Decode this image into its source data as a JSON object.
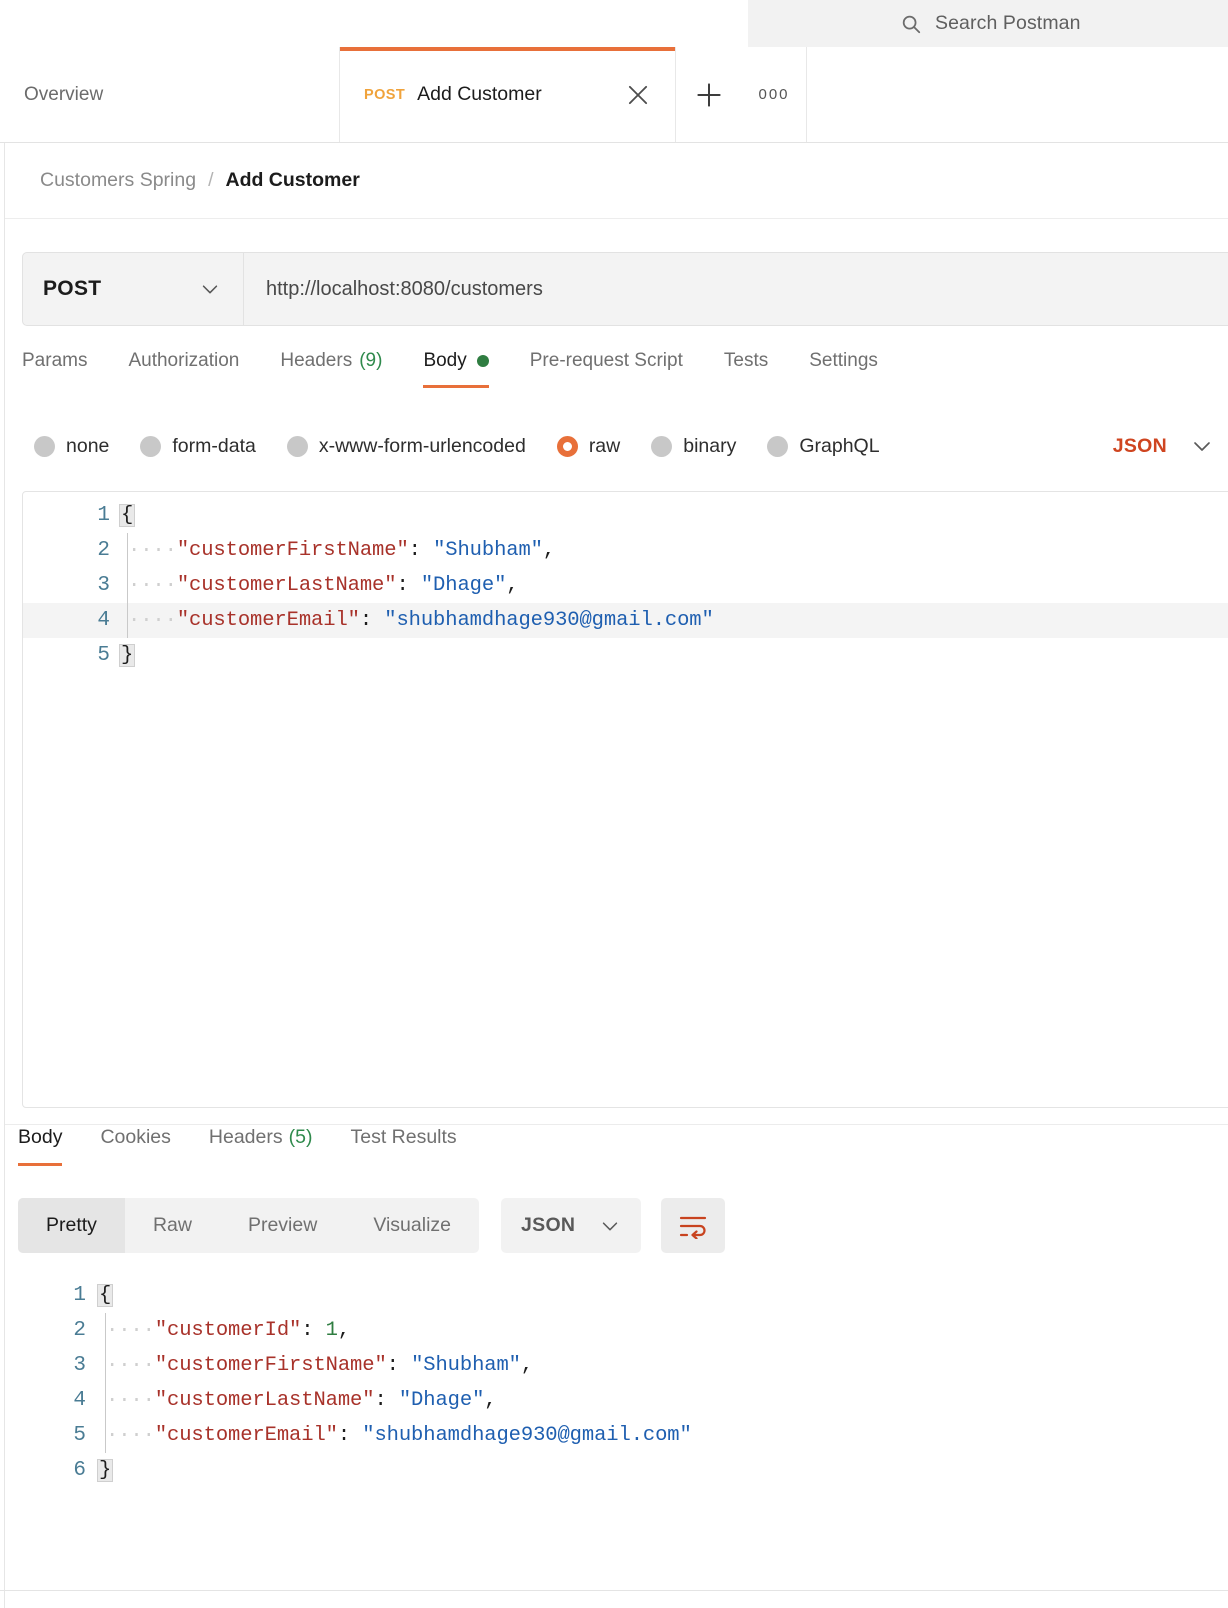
{
  "search": {
    "placeholder": "Search Postman",
    "icon": "search-icon"
  },
  "tabs": {
    "overview_label": "Overview",
    "request": {
      "method": "POST",
      "name": "Add Customer"
    },
    "close_icon": "close-icon",
    "new_tab_icon": "plus-icon",
    "more_label": "000"
  },
  "breadcrumb": {
    "collection": "Customers Spring",
    "separator": "/",
    "request": "Add Customer"
  },
  "url_bar": {
    "method": "POST",
    "method_chevron": "chevron-down-icon",
    "url": "http://localhost:8080/customers"
  },
  "request_tabs": [
    {
      "label": "Params",
      "selected": false
    },
    {
      "label": "Authorization",
      "selected": false
    },
    {
      "label": "Headers",
      "count": "(9)",
      "selected": false
    },
    {
      "label": "Body",
      "dot": true,
      "selected": true
    },
    {
      "label": "Pre-request Script",
      "selected": false
    },
    {
      "label": "Tests",
      "selected": false
    },
    {
      "label": "Settings",
      "selected": false
    }
  ],
  "body_types": [
    {
      "label": "none",
      "selected": false
    },
    {
      "label": "form-data",
      "selected": false
    },
    {
      "label": "x-www-form-urlencoded",
      "selected": false
    },
    {
      "label": "raw",
      "selected": true
    },
    {
      "label": "binary",
      "selected": false
    },
    {
      "label": "GraphQL",
      "selected": false
    }
  ],
  "body_format": {
    "label": "JSON",
    "chevron": "chevron-down-icon",
    "color": "#cf4520"
  },
  "request_body": {
    "lines": [
      {
        "num": "1",
        "open_brace": "{",
        "highlight": false
      },
      {
        "num": "2",
        "indent": "····",
        "key": "\"customerFirstName\"",
        "punct": ": ",
        "value": "\"Shubham\"",
        "value_type": "string",
        "trail": ",",
        "highlight": false
      },
      {
        "num": "3",
        "indent": "····",
        "key": "\"customerLastName\"",
        "punct": ": ",
        "value": "\"Dhage\"",
        "value_type": "string",
        "trail": ",",
        "highlight": false
      },
      {
        "num": "4",
        "indent": "····",
        "key": "\"customerEmail\"",
        "punct": ": ",
        "value": "\"shubhamdhage930@gmail.com\"",
        "value_type": "string",
        "trail": "",
        "highlight": true
      },
      {
        "num": "5",
        "close_brace": "}",
        "highlight": false
      }
    ]
  },
  "response_tabs": [
    {
      "label": "Body",
      "selected": true
    },
    {
      "label": "Cookies",
      "selected": false
    },
    {
      "label": "Headers",
      "count": "(5)",
      "selected": false
    },
    {
      "label": "Test Results",
      "selected": false
    }
  ],
  "response_toolbar": {
    "views": [
      {
        "label": "Pretty",
        "selected": true
      },
      {
        "label": "Raw",
        "selected": false
      },
      {
        "label": "Preview",
        "selected": false
      },
      {
        "label": "Visualize",
        "selected": false
      }
    ],
    "format": {
      "label": "JSON",
      "chevron": "chevron-down-icon"
    },
    "wrap_icon": "word-wrap-icon"
  },
  "response_body": {
    "lines": [
      {
        "num": "1",
        "open_brace": "{"
      },
      {
        "num": "2",
        "indent": "····",
        "key": "\"customerId\"",
        "punct": ": ",
        "value": "1",
        "value_type": "number",
        "trail": ","
      },
      {
        "num": "3",
        "indent": "····",
        "key": "\"customerFirstName\"",
        "punct": ": ",
        "value": "\"Shubham\"",
        "value_type": "string",
        "trail": ","
      },
      {
        "num": "4",
        "indent": "····",
        "key": "\"customerLastName\"",
        "punct": ": ",
        "value": "\"Dhage\"",
        "value_type": "string",
        "trail": ","
      },
      {
        "num": "5",
        "indent": "····",
        "key": "\"customerEmail\"",
        "punct": ": ",
        "value": "\"shubhamdhage930@gmail.com\"",
        "value_type": "string",
        "trail": ""
      },
      {
        "num": "6",
        "close_brace": "}"
      }
    ]
  }
}
